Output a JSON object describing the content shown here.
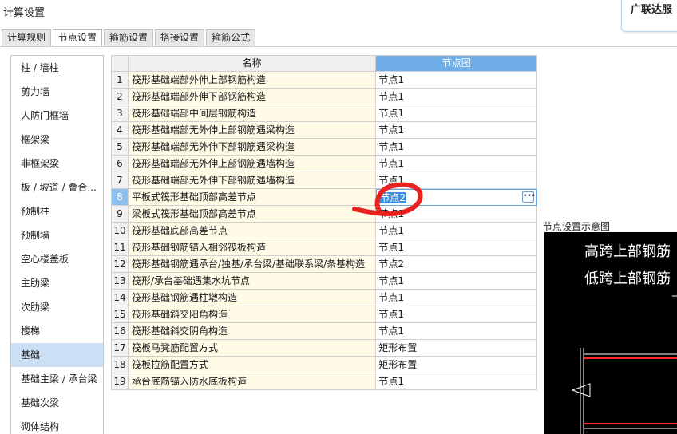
{
  "window": {
    "title": "计算设置",
    "brand": "广联达服"
  },
  "tabs": [
    {
      "label": "计算规则",
      "active": false
    },
    {
      "label": "节点设置",
      "active": true
    },
    {
      "label": "箍筋设置",
      "active": false
    },
    {
      "label": "搭接设置",
      "active": false
    },
    {
      "label": "箍筋公式",
      "active": false
    }
  ],
  "sidebar": {
    "items": [
      {
        "label": "柱 / 墙柱"
      },
      {
        "label": "剪力墙"
      },
      {
        "label": "人防门框墙"
      },
      {
        "label": "框架梁"
      },
      {
        "label": "非框架梁"
      },
      {
        "label": "板 / 坡道 / 叠合..."
      },
      {
        "label": "预制柱"
      },
      {
        "label": "预制墙"
      },
      {
        "label": "空心楼盖板"
      },
      {
        "label": "主肋梁"
      },
      {
        "label": "次肋梁"
      },
      {
        "label": "楼梯"
      },
      {
        "label": "基础",
        "selected": true
      },
      {
        "label": "基础主梁 / 承台梁"
      },
      {
        "label": "基础次梁"
      },
      {
        "label": "砌体结构"
      }
    ]
  },
  "grid": {
    "headers": {
      "name": "名称",
      "node": "节点图"
    },
    "rows": [
      {
        "num": "1",
        "name": "筏形基础端部外伸上部钢筋构造",
        "node": "节点1"
      },
      {
        "num": "2",
        "name": "筏形基础端部外伸下部钢筋构造",
        "node": "节点1"
      },
      {
        "num": "3",
        "name": "筏形基础端部中间层钢筋构造",
        "node": "节点1"
      },
      {
        "num": "4",
        "name": "筏形基础端部无外伸上部钢筋遇梁构造",
        "node": "节点1"
      },
      {
        "num": "5",
        "name": "筏形基础端部无外伸下部钢筋遇梁构造",
        "node": "节点1"
      },
      {
        "num": "6",
        "name": "筏形基础端部无外伸上部钢筋遇墙构造",
        "node": "节点1"
      },
      {
        "num": "7",
        "name": "筏形基础端部无外伸下部钢筋遇墙构造",
        "node": "节点1"
      },
      {
        "num": "8",
        "name": "平板式筏形基础顶部高差节点",
        "node": "节点2",
        "editing": true
      },
      {
        "num": "9",
        "name": "梁板式筏形基础顶部高差节点",
        "node": "节点1"
      },
      {
        "num": "10",
        "name": "筏形基础底部高差节点",
        "node": "节点1"
      },
      {
        "num": "11",
        "name": "筏形基础钢筋锚入相邻筏板构造",
        "node": "节点1"
      },
      {
        "num": "12",
        "name": "筏形基础钢筋遇承台/独基/承台梁/基础联系梁/条基构造",
        "node": "节点2"
      },
      {
        "num": "13",
        "name": "筏形/承台基础遇集水坑节点",
        "node": "节点1"
      },
      {
        "num": "14",
        "name": "筏形基础钢筋遇柱墩构造",
        "node": "节点1"
      },
      {
        "num": "15",
        "name": "筏形基础斜交阳角构造",
        "node": "节点1"
      },
      {
        "num": "16",
        "name": "筏形基础斜交阴角构造",
        "node": "节点1"
      },
      {
        "num": "17",
        "name": "筏板马凳筋配置方式",
        "node": "矩形布置"
      },
      {
        "num": "18",
        "name": "筏板拉筋配置方式",
        "node": "矩形布置"
      },
      {
        "num": "19",
        "name": "承台底筋锚入防水底板构造",
        "node": "节点1"
      }
    ]
  },
  "preview": {
    "label": "节点设置示意图",
    "line1": "高跨上部钢筋",
    "line2": "低跨上部钢筋"
  },
  "colors": {
    "header_accent": "#6faee6",
    "selected_side": "#cce0f5",
    "name_cell_bg": "#fffbe6",
    "annotation": "#e8231f",
    "rebar_red": "#ff2a2a"
  }
}
